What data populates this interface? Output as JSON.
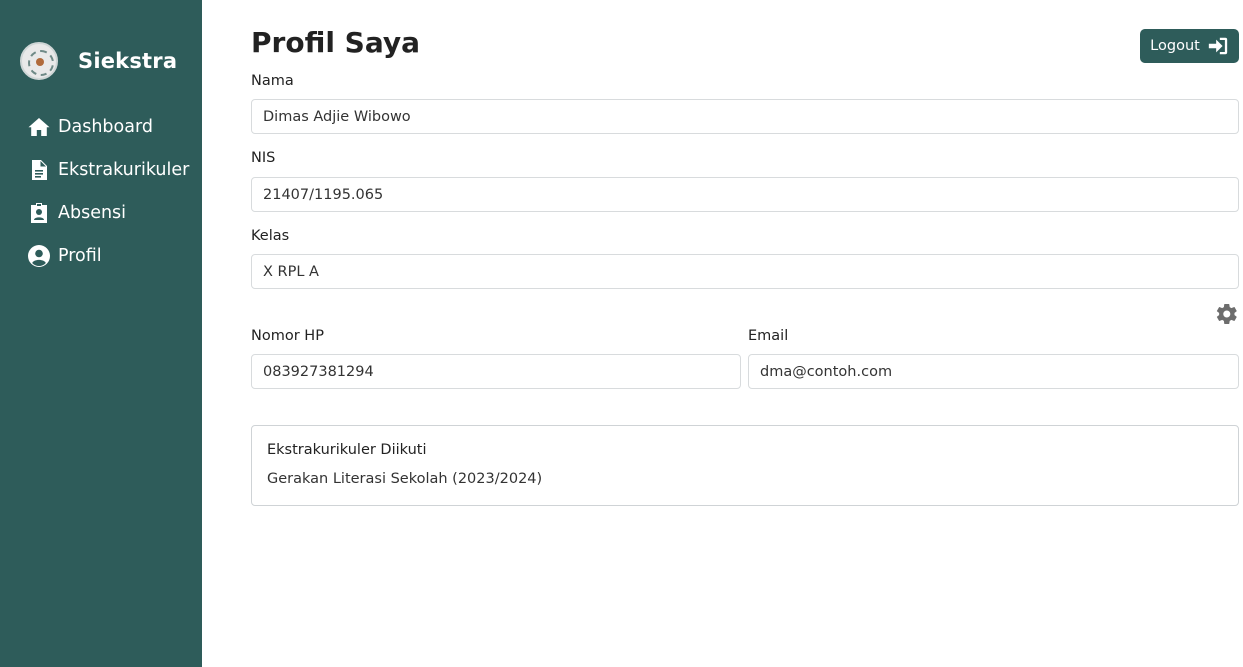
{
  "sidebar": {
    "brand": "Siekstra",
    "items": [
      {
        "label": "Dashboard",
        "icon": "home-icon"
      },
      {
        "label": "Ekstrakurikuler",
        "icon": "document-icon"
      },
      {
        "label": "Absensi",
        "icon": "id-badge-icon"
      },
      {
        "label": "Profil",
        "icon": "user-circle-icon"
      }
    ]
  },
  "header": {
    "title": "Profil Saya",
    "logout_label": "Logout"
  },
  "form": {
    "nama_label": "Nama",
    "nama_value": "Dimas Adjie Wibowo",
    "nis_label": "NIS",
    "nis_value": "21407/1195.065",
    "kelas_label": "Kelas",
    "kelas_value": "X RPL A",
    "hp_label": "Nomor HP",
    "hp_value": "083927381294",
    "email_label": "Email",
    "email_value": "dma@contoh.com"
  },
  "ekskul": {
    "title": "Ekstrakurikuler Diikuti",
    "items": [
      "Gerakan Literasi Sekolah (2023/2024)"
    ]
  },
  "colors": {
    "sidebar": "#2e5c5a",
    "accent": "#2e5c5a"
  }
}
